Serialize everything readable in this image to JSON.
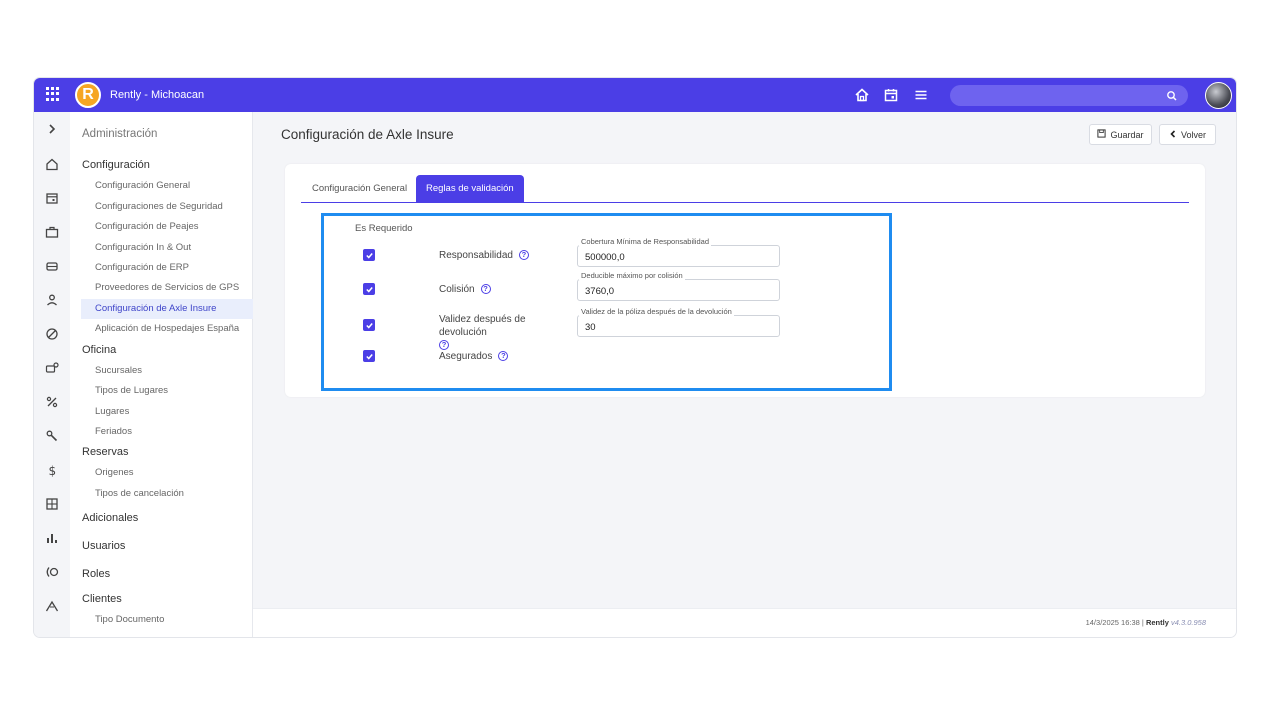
{
  "app": {
    "title": "Rently - Michoacan",
    "logo_letter": "R"
  },
  "sidebar": {
    "header": "Administración",
    "groups": [
      {
        "label": "Configuración",
        "items": [
          "Configuración General",
          "Configuraciones de Seguridad",
          "Configuración de Peajes",
          "Configuración In & Out",
          "Configuración de ERP",
          "Proveedores de Servicios de GPS",
          "Configuración de Axle Insure",
          "Aplicación de Hospedajes España"
        ]
      },
      {
        "label": "Oficina",
        "items": [
          "Sucursales",
          "Tipos de Lugares",
          "Lugares",
          "Feriados"
        ]
      },
      {
        "label": "Reservas",
        "items": [
          "Origenes",
          "Tipos de cancelación"
        ]
      },
      {
        "label": "Adicionales",
        "items": []
      },
      {
        "label": "Usuarios",
        "items": []
      },
      {
        "label": "Roles",
        "items": []
      },
      {
        "label": "Clientes",
        "items": [
          "Tipo Documento"
        ]
      }
    ],
    "active_item": "Configuración de Axle Insure"
  },
  "page": {
    "title": "Configuración de Axle Insure",
    "save_label": "Guardar",
    "back_label": "Volver"
  },
  "tabs": [
    {
      "label": "Configuración General",
      "active": false
    },
    {
      "label": "Reglas de validación",
      "active": true
    }
  ],
  "rules": {
    "section_label": "Es Requerido",
    "items": [
      {
        "label": "Responsabilidad",
        "checked": true,
        "field_label": "Cobertura Mínima de Responsabilidad",
        "field_value": "500000,0"
      },
      {
        "label": "Colisión",
        "checked": true,
        "field_label": "Deducible máximo por colisión",
        "field_value": "3760,0"
      },
      {
        "label": "Validez después de devolución",
        "checked": true,
        "field_label": "Validez de la póliza después de la devolución",
        "field_value": "30"
      },
      {
        "label": "Asegurados",
        "checked": true
      }
    ]
  },
  "footer": {
    "datetime": "14/3/2025 16:38",
    "separator": "|",
    "brand": "Rently",
    "version": "v4.3.0.958"
  },
  "colors": {
    "primary": "#4b3ee6",
    "highlight": "#1f8cf0",
    "logo": "#f6a623"
  },
  "icons": [
    "apps-icon",
    "home-icon",
    "calendar-icon",
    "menu-icon",
    "search-icon",
    "chevron-right-icon",
    "briefcase-icon",
    "car-icon",
    "person-icon",
    "ban-icon",
    "vehicle-settings-icon",
    "percent-icon",
    "wrench-icon",
    "dollar-icon",
    "calculator-icon",
    "bar-chart-icon",
    "signal-icon",
    "mountain-icon",
    "save-icon",
    "chevron-left-icon",
    "help-icon",
    "checkbox-icon"
  ]
}
